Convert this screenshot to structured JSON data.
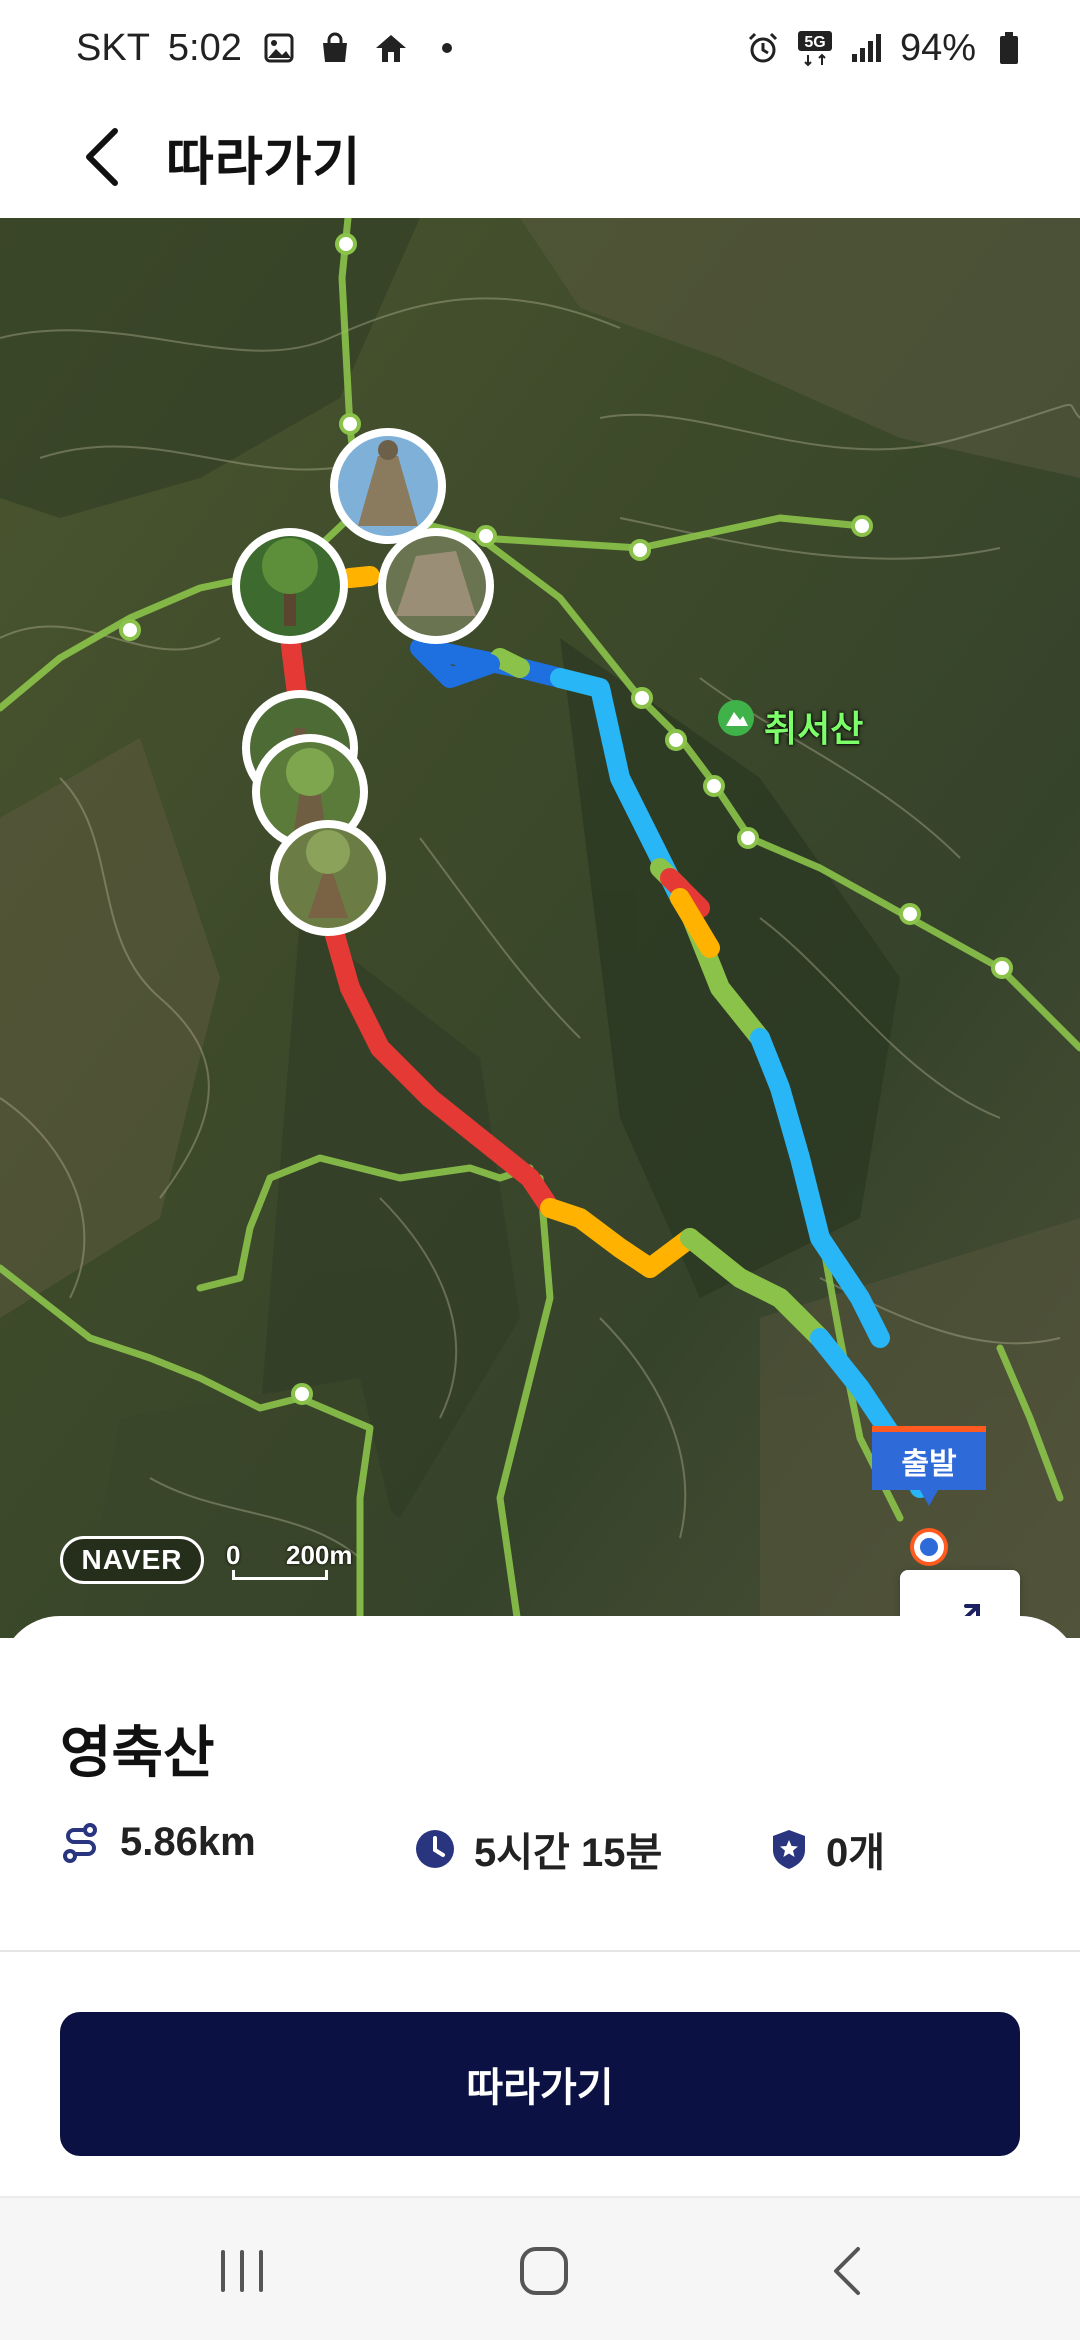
{
  "status_bar": {
    "carrier": "SKT",
    "time": "5:02",
    "battery": "94%",
    "network": "5G",
    "icons": [
      "gallery-icon",
      "shopping-bag-icon",
      "app-icon",
      "dot-icon",
      "alarm-icon",
      "5g-icon",
      "signal-icon",
      "battery-icon"
    ]
  },
  "header": {
    "back_icon": "chevron-left-icon",
    "title": "따라가기"
  },
  "map": {
    "peak_label": "취서산",
    "start_label": "출발",
    "logo": "NAVER",
    "scale": {
      "zero": "0",
      "distance": "200m"
    },
    "route_colors": [
      "#e53935",
      "#ffb300",
      "#8bc34a",
      "#29b6f6",
      "#1e6fe0"
    ],
    "trail_color": "#8bc34a",
    "controls": [
      "slope-icon",
      "swap-direction-icon"
    ]
  },
  "course": {
    "name": "영축산",
    "distance": "5.86km",
    "duration": "5시간 15분",
    "badges": "0개"
  },
  "primary_button": {
    "label": "따라가기",
    "color": "#0b1142"
  },
  "nav_bar": {
    "items": [
      "recent-apps-icon",
      "home-icon",
      "back-icon"
    ]
  }
}
